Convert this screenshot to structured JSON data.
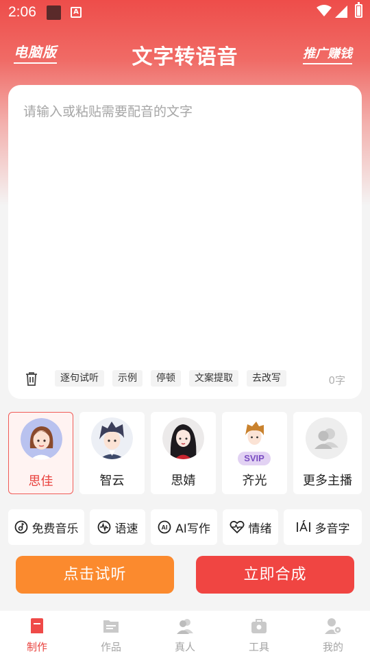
{
  "status_bar": {
    "time": "2:06"
  },
  "header": {
    "pc_label": "电脑版",
    "title": "文字转语音",
    "promo_label": "推广赚钱"
  },
  "editor": {
    "placeholder": "请输入或粘贴需要配音的文字",
    "chips": [
      "逐句试听",
      "示例",
      "停顿",
      "文案提取",
      "去改写"
    ],
    "char_count": "0字"
  },
  "voices": [
    {
      "name": "思佳",
      "selected": true
    },
    {
      "name": "智云",
      "selected": false
    },
    {
      "name": "思婧",
      "selected": false
    },
    {
      "name": "齐光",
      "selected": false,
      "badge": "SVIP"
    },
    {
      "name": "更多主播",
      "selected": false
    }
  ],
  "tools": [
    {
      "label": "免费音乐",
      "icon": "music-disc-icon"
    },
    {
      "label": "语速",
      "icon": "waveform-icon"
    },
    {
      "label": "AI写作",
      "icon": "ai-icon"
    },
    {
      "label": "情绪",
      "icon": "heart-pulse-icon"
    },
    {
      "label": "多音字",
      "icon": "pinyin-icon"
    }
  ],
  "actions": {
    "listen": "点击试听",
    "compose": "立即合成"
  },
  "nav": [
    {
      "label": "制作",
      "active": true
    },
    {
      "label": "作品",
      "active": false
    },
    {
      "label": "真人",
      "active": false
    },
    {
      "label": "工具",
      "active": false
    },
    {
      "label": "我的",
      "active": false
    }
  ],
  "colors": {
    "brand_red": "#ee4d4a",
    "listen_orange": "#fb8a2e",
    "compose_red": "#f04542"
  }
}
